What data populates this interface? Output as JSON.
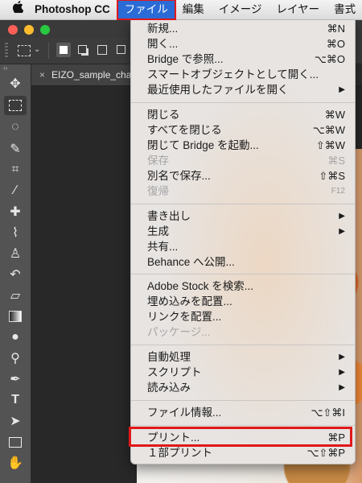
{
  "menubar": {
    "apple": "",
    "app_name": "Photoshop CC",
    "items": [
      "ファイル",
      "編集",
      "イメージ",
      "レイヤー",
      "書式"
    ]
  },
  "document": {
    "tab_title": "EIZO_sample_cha"
  },
  "toolbar": {
    "collapse": "››"
  },
  "menu": {
    "items": [
      {
        "label": "新規...",
        "shortcut": "⌘N"
      },
      {
        "label": "開く...",
        "shortcut": "⌘O"
      },
      {
        "label": "Bridge で参照...",
        "shortcut": "⌥⌘O"
      },
      {
        "label": "スマートオブジェクトとして開く...",
        "shortcut": ""
      },
      {
        "label": "最近使用したファイルを開く",
        "shortcut": "",
        "submenu": true
      },
      {
        "label": "閉じる",
        "shortcut": "⌘W"
      },
      {
        "label": "すべてを閉じる",
        "shortcut": "⌥⌘W"
      },
      {
        "label": "閉じて Bridge を起動...",
        "shortcut": "⇧⌘W"
      },
      {
        "label": "保存",
        "shortcut": "⌘S",
        "disabled": true
      },
      {
        "label": "別名で保存...",
        "shortcut": "⇧⌘S"
      },
      {
        "label": "復帰",
        "shortcut": "F12",
        "disabled": true
      },
      {
        "label": "書き出し",
        "submenu": true
      },
      {
        "label": "生成",
        "submenu": true
      },
      {
        "label": "共有..."
      },
      {
        "label": "Behance へ公開..."
      },
      {
        "label": "Adobe Stock を検索..."
      },
      {
        "label": "埋め込みを配置..."
      },
      {
        "label": "リンクを配置..."
      },
      {
        "label": "パッケージ...",
        "disabled": true
      },
      {
        "label": "自動処理",
        "submenu": true
      },
      {
        "label": "スクリプト",
        "submenu": true
      },
      {
        "label": "読み込み",
        "submenu": true
      },
      {
        "label": "ファイル情報...",
        "shortcut": "⌥⇧⌘I"
      },
      {
        "label": "プリント...",
        "shortcut": "⌘P"
      },
      {
        "label": "１部プリント",
        "shortcut": "⌥⇧⌘P"
      }
    ]
  },
  "colors": {
    "menubar_active": "#2a6bd6",
    "highlight_box": "#e01818"
  }
}
